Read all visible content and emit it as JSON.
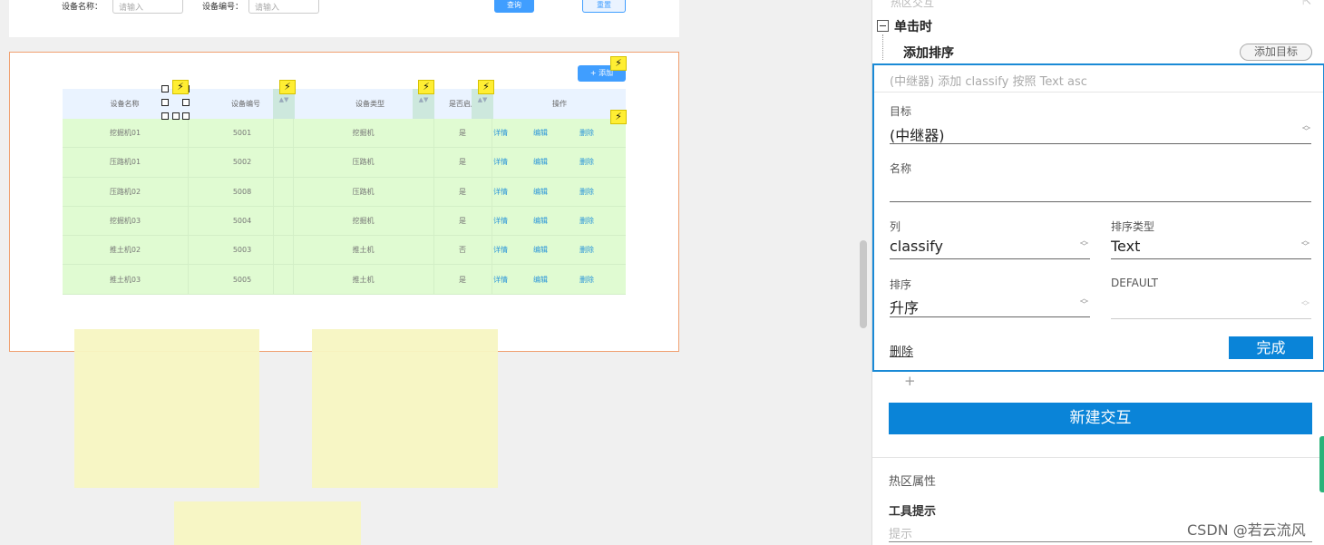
{
  "filter": {
    "name_label": "设备名称：",
    "name_placeholder": "请输入",
    "code_label": "设备编号：",
    "code_placeholder": "请输入",
    "query_label": "查询",
    "reset_label": "重置"
  },
  "table": {
    "add_label": "+ 添加",
    "headers": [
      "设备名称",
      "设备编号",
      "设备类型",
      "是否启用",
      "操作"
    ],
    "sort_glyph": "▲▼",
    "rows": [
      [
        "挖掘机01",
        "5001",
        "挖掘机",
        "是"
      ],
      [
        "压路机01",
        "5002",
        "压路机",
        "是"
      ],
      [
        "压路机02",
        "5008",
        "压路机",
        "是"
      ],
      [
        "挖掘机03",
        "5004",
        "挖掘机",
        "是"
      ],
      [
        "推土机02",
        "5003",
        "推土机",
        "否"
      ],
      [
        "推土机03",
        "5005",
        "推土机",
        "是"
      ]
    ],
    "actions": [
      "详情",
      "编辑",
      "删除"
    ]
  },
  "icons": {
    "interaction": "lightning-icon",
    "bolt_glyph": "⚡"
  },
  "panel": {
    "top_cut_text": "热区交互",
    "event": "单击时",
    "action": "添加排序",
    "add_target": "添加目标",
    "summary": "(中继器) 添加 classify 按照 Text asc",
    "target_label": "目标",
    "target_value": "(中继器)",
    "name_label": "名称",
    "name_value": "",
    "column_label": "列",
    "column_value": "classify",
    "sorttype_label": "排序类型",
    "sorttype_value": "Text",
    "order_label": "排序",
    "order_value": "升序",
    "default_label": "DEFAULT",
    "default_value": "",
    "delete_label": "删除",
    "done_label": "完成",
    "plus": "+",
    "new_interaction": "新建交互",
    "hot_props": "热区属性",
    "tooltip_label": "工具提示",
    "tooltip_placeholder": "提示"
  },
  "watermark": "CSDN @若云流风",
  "colors": {
    "accent": "#0a84d8",
    "table_body": "#e0fbd2",
    "table_head": "#eaf3ff",
    "frame": "#f0a070"
  }
}
